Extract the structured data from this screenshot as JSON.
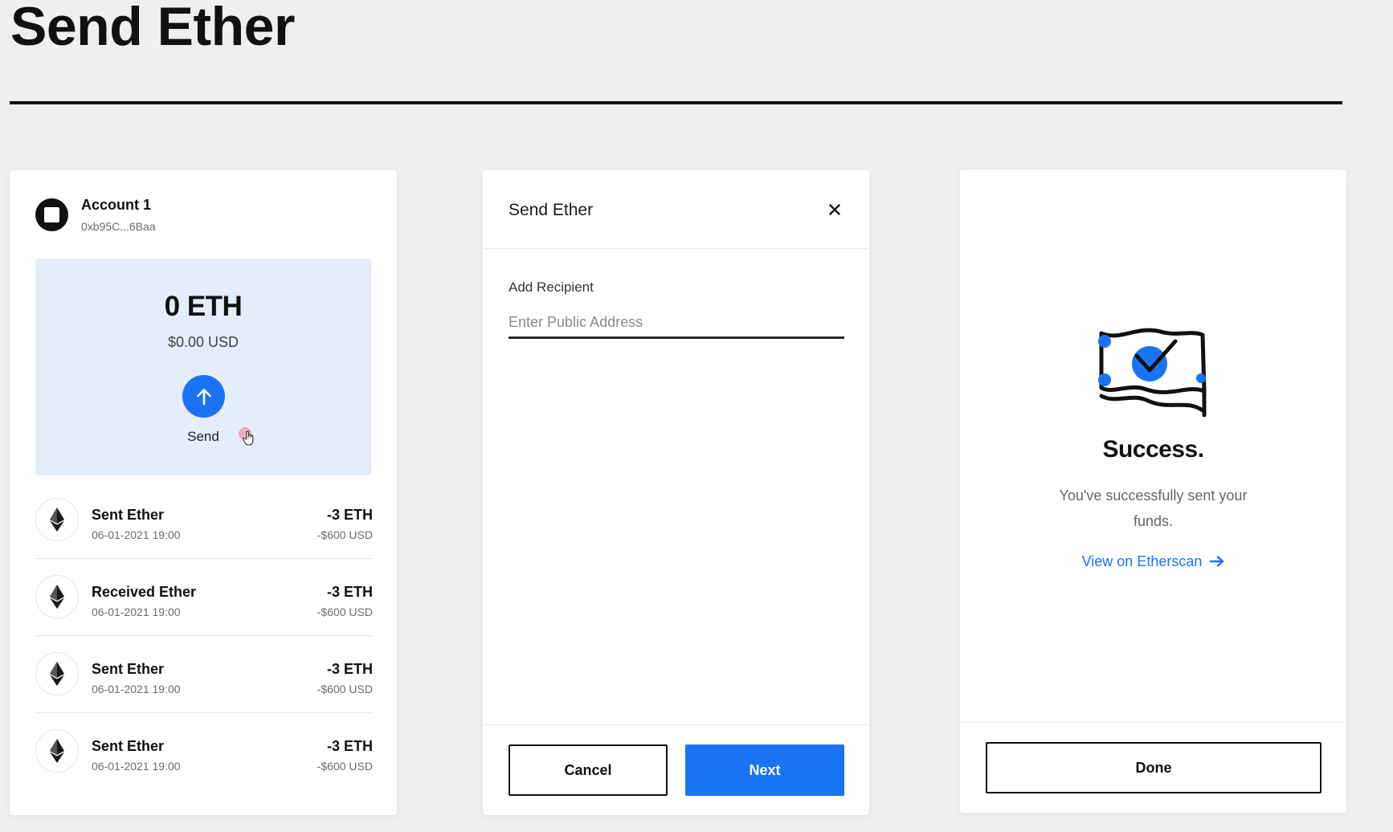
{
  "page": {
    "title": "Send Ether"
  },
  "wallet": {
    "account_name": "Account 1",
    "account_address": "0xb95C...6Baa",
    "balance_eth": "0 ETH",
    "balance_usd": "$0.00 USD",
    "send_label": "Send",
    "transactions": [
      {
        "title": "Sent Ether",
        "date": "06-01-2021 19:00",
        "amount": "-3 ETH",
        "usd": "-$600 USD"
      },
      {
        "title": "Received Ether",
        "date": "06-01-2021 19:00",
        "amount": "-3 ETH",
        "usd": "-$600 USD"
      },
      {
        "title": "Sent Ether",
        "date": "06-01-2021 19:00",
        "amount": "-3 ETH",
        "usd": "-$600 USD"
      },
      {
        "title": "Sent Ether",
        "date": "06-01-2021 19:00",
        "amount": "-3 ETH",
        "usd": "-$600 USD"
      }
    ]
  },
  "send_modal": {
    "title": "Send Ether",
    "recipient_label": "Add Recipient",
    "recipient_value": "",
    "recipient_placeholder": "Enter Public Address",
    "cancel_label": "Cancel",
    "next_label": "Next"
  },
  "success": {
    "heading": "Success.",
    "message": "You've successfully sent your funds.",
    "link_label": "View on Etherscan",
    "done_label": "Done"
  },
  "colors": {
    "accent": "#1a73f5",
    "panel": "#e4edf9",
    "background": "#efefef"
  },
  "icons": [
    "ethereum-icon",
    "arrow-up-icon",
    "close-icon",
    "arrow-right-icon",
    "hand-cursor-icon",
    "money-check-icon"
  ]
}
